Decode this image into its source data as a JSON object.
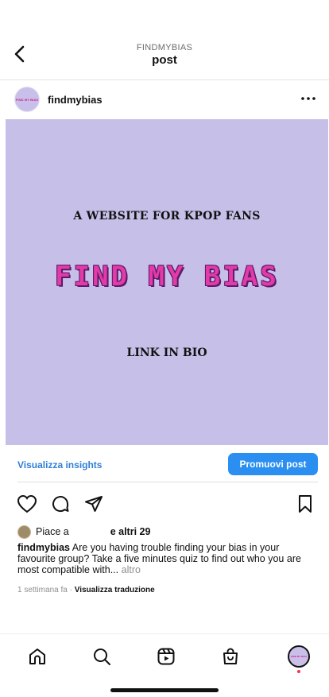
{
  "header": {
    "subtitle": "FINDMYBIAS",
    "title": "post"
  },
  "profile": {
    "username": "findmybias",
    "avatar_text": "FIND MY BIAS"
  },
  "post_image": {
    "line1": "A WEBSITE FOR KPOP FANS",
    "logo": "FIND MY BIAS",
    "line3": "LINK IN BIO",
    "background_color": "#c6bfe8",
    "logo_color": "#e23aa6"
  },
  "insights": {
    "link_label": "Visualizza insights",
    "promote_label": "Promuovi post",
    "accent_color": "#2a8ff1"
  },
  "actions": {
    "icons": [
      "heart-icon",
      "comment-icon",
      "share-icon",
      "bookmark-icon"
    ]
  },
  "likes": {
    "prefix": "Piace a",
    "suffix": "e altri 29"
  },
  "caption": {
    "username": "findmybias",
    "text": "Are you having trouble finding your bias in your favourite group? Take a five minutes quiz to find out who you are most compatible with...",
    "more": "altro"
  },
  "meta": {
    "time": "1 settimana fa",
    "separator": "·",
    "translate": "Visualizza traduzione"
  },
  "bottom_nav": {
    "icons": [
      "home-icon",
      "search-icon",
      "reels-icon",
      "shop-icon",
      "profile-avatar"
    ]
  }
}
